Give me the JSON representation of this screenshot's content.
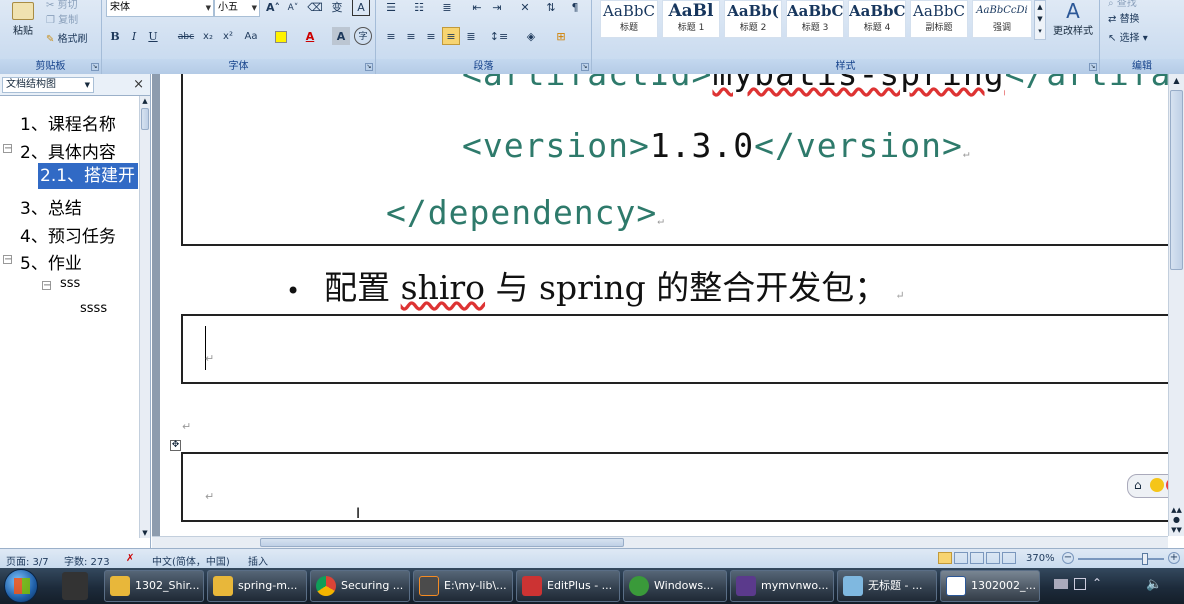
{
  "ribbon": {
    "clipboard": {
      "paste": "粘贴",
      "copy": "复制",
      "format_painter": "格式刷",
      "cut": "剪切",
      "label": "剪贴板"
    },
    "font": {
      "name": "宋体",
      "size": "小五",
      "label": "字体",
      "bold": "B",
      "italic": "I",
      "underline": "U",
      "strike": "abc",
      "sub": "x₂",
      "sup": "x²",
      "case": "Aa",
      "grow": "A",
      "shrink": "A",
      "phonetic": "变",
      "border_char": "A",
      "clear": "A",
      "encircle": "字"
    },
    "paragraph": {
      "label": "段落"
    },
    "styles": {
      "label": "样式",
      "items": [
        {
          "preview": "AaBbC",
          "name": "标题"
        },
        {
          "preview": "AaBl",
          "name": "标题 1"
        },
        {
          "preview": "AaBb(",
          "name": "标题 2"
        },
        {
          "preview": "AaBbC",
          "name": "标题 3"
        },
        {
          "preview": "AaBbC",
          "name": "标题 4"
        },
        {
          "preview": "AaBbC",
          "name": "副标题"
        },
        {
          "preview": "AaBbCcDi",
          "name": "强调"
        }
      ],
      "change": "更改样式"
    },
    "editing": {
      "label": "编辑",
      "replace": "替换",
      "select": "选择",
      "find": "查找"
    }
  },
  "docmap": {
    "title": "文档结构图",
    "close": "×",
    "items": [
      {
        "text": "1、课程名称"
      },
      {
        "text": "2、具体内容"
      },
      {
        "text": "2.1、搭建开"
      },
      {
        "text": "3、总结"
      },
      {
        "text": "4、预习任务"
      },
      {
        "text": "5、作业"
      },
      {
        "text": "sss"
      },
      {
        "text": "ssss"
      }
    ]
  },
  "document": {
    "line1": {
      "open": "<artifactId>",
      "text": "mybatis-spring",
      "close": "</artifa"
    },
    "line2": {
      "open": "<version>",
      "text": "1.3.0",
      "close": "</version>"
    },
    "line3": {
      "tag": "</dependency>"
    },
    "bullet": {
      "dot": "•",
      "cn1": "配置 ",
      "en1": "shiro",
      "cn2": " 与 ",
      "en2": "spring",
      "cn3": " 的整合开发包；"
    },
    "para_mark": "↵",
    "table_move": "✥"
  },
  "statusbar": {
    "page": "页面: 3/7",
    "words": "字数: 273",
    "lang": "中文(简体，中国)",
    "mode": "插入",
    "zoom": "370%",
    "zoom_minus": "−",
    "zoom_plus": "+"
  },
  "taskbar": {
    "items": [
      {
        "label": "1302_Shir..."
      },
      {
        "label": "spring-m..."
      },
      {
        "label": "Securing ..."
      },
      {
        "label": "E:\\my-lib\\..."
      },
      {
        "label": "EditPlus - ..."
      },
      {
        "label": "Windows..."
      },
      {
        "label": "mymvnwo..."
      },
      {
        "label": "无标题 - ..."
      },
      {
        "label": "1302002_..."
      }
    ]
  },
  "colors": {
    "accent": "#f7d471",
    "tag": "#2e7a6b",
    "taskbar": "#1d2b3b"
  }
}
